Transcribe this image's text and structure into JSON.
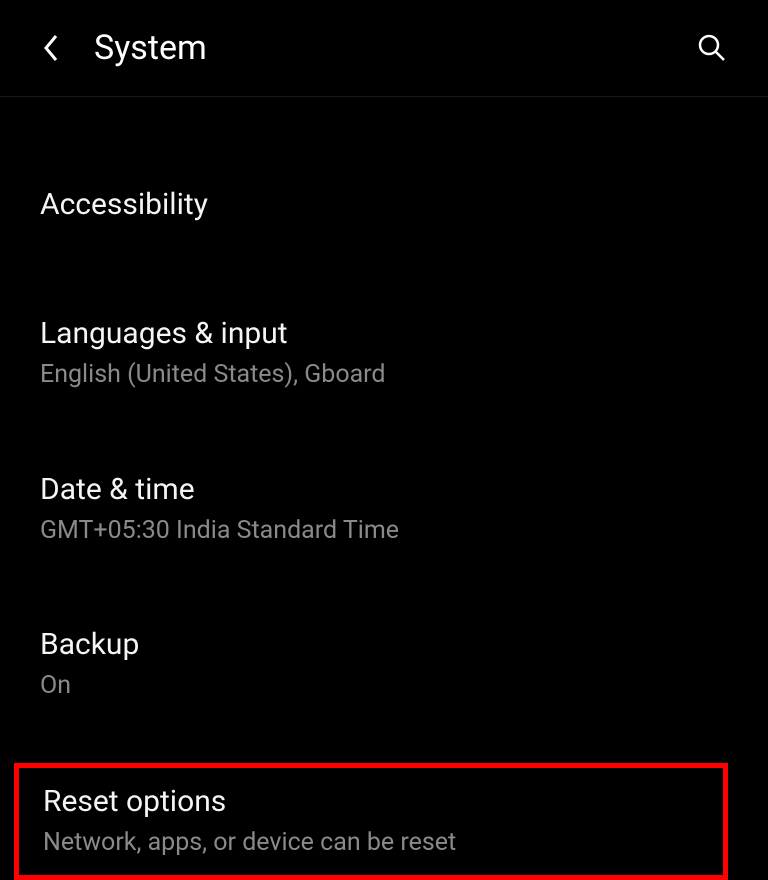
{
  "header": {
    "title": "System"
  },
  "settings": [
    {
      "title": "Accessibility",
      "subtitle": null
    },
    {
      "title": "Languages & input",
      "subtitle": "English (United States), Gboard"
    },
    {
      "title": "Date & time",
      "subtitle": "GMT+05:30 India Standard Time"
    },
    {
      "title": "Backup",
      "subtitle": "On"
    },
    {
      "title": "Reset options",
      "subtitle": "Network, apps, or device can be reset"
    }
  ]
}
